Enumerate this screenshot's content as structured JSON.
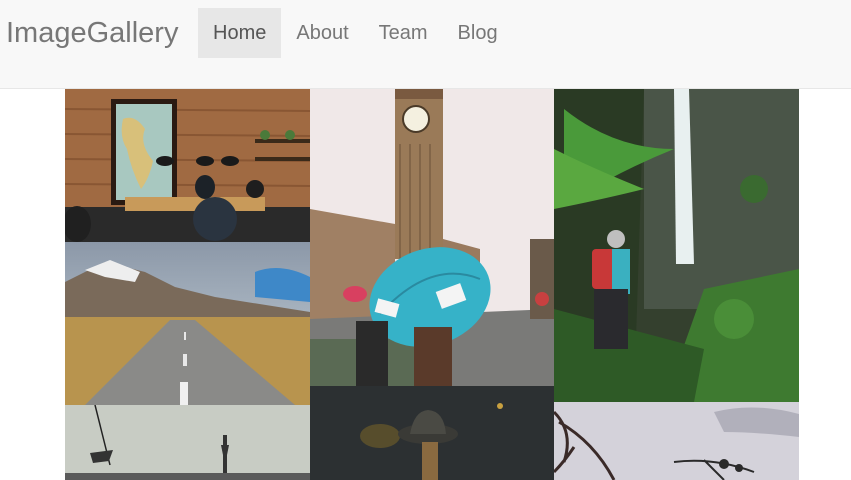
{
  "brand": "ImageGallery",
  "nav": {
    "items": [
      {
        "label": "Home",
        "active": true
      },
      {
        "label": "About",
        "active": false
      },
      {
        "label": "Team",
        "active": false
      },
      {
        "label": "Blog",
        "active": false
      }
    ]
  },
  "colors": {
    "navbar_bg": "#f8f8f8",
    "nav_active_bg": "#e7e7e7",
    "nav_text": "#777777"
  },
  "gallery": {
    "photos": [
      {
        "subject": "cafe-with-world-map"
      },
      {
        "subject": "desert-road-mountains"
      },
      {
        "subject": "tower-silhouette"
      },
      {
        "subject": "big-ben-blue-umbrella"
      },
      {
        "subject": "hat-in-dark"
      },
      {
        "subject": "hiker-at-waterfall"
      },
      {
        "subject": "branches-grey-sky"
      }
    ]
  }
}
